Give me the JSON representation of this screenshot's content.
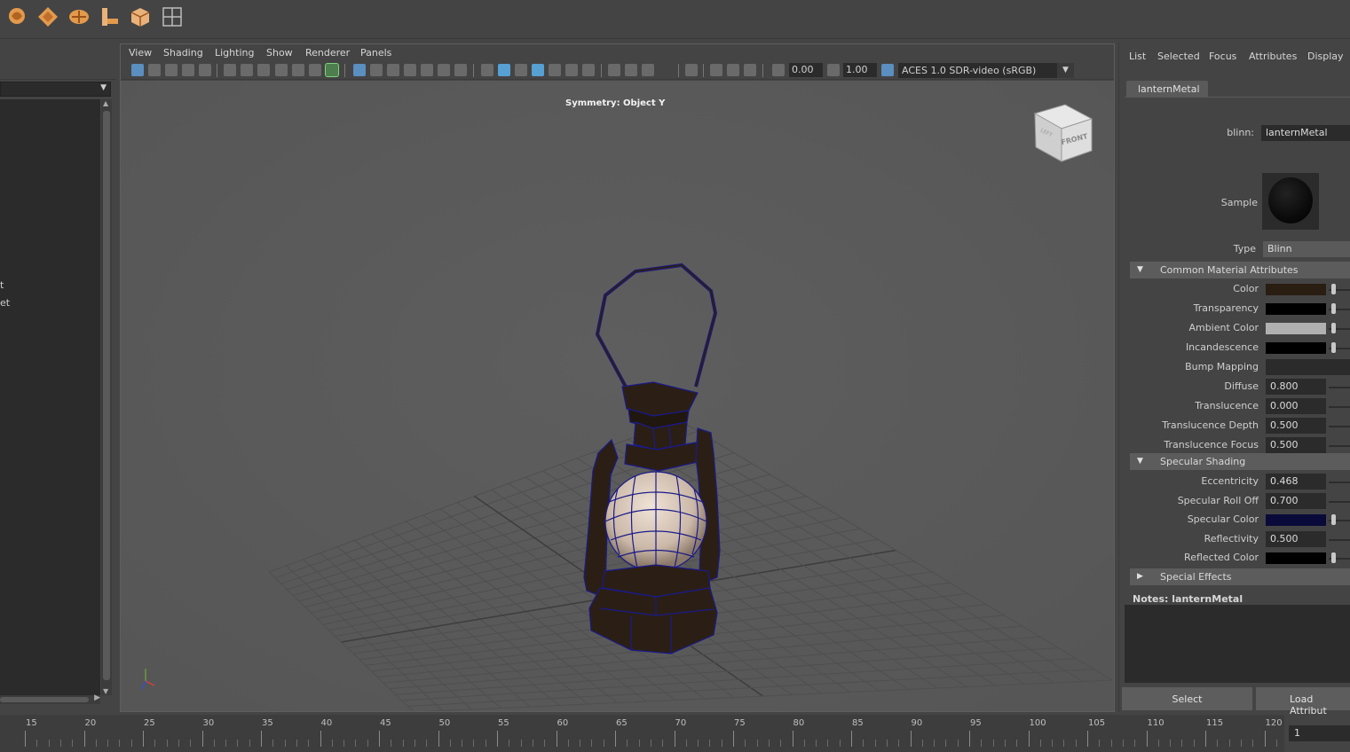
{
  "shelf": {
    "icons": [
      "lasso-select-icon",
      "diamond-select-icon",
      "paint-select-icon",
      "move-tool-icon",
      "cube-tool-icon",
      "grid-layout-icon"
    ]
  },
  "outliner": {
    "partial_items": [
      "t",
      "et"
    ]
  },
  "viewport": {
    "menus": [
      "View",
      "Shading",
      "Lighting",
      "Show",
      "Renderer",
      "Panels"
    ],
    "exposure": "0.00",
    "gamma": "1.00",
    "color_space": "ACES 1.0 SDR-video (sRGB)",
    "symmetry_label": "Symmetry: Object Y",
    "view_cube_front": "FRONT",
    "view_cube_left": "LEFT"
  },
  "attribute_editor": {
    "menus": [
      "List",
      "Selected",
      "Focus",
      "Attributes",
      "Display"
    ],
    "tab": "lanternMetal",
    "node_type_label": "blinn:",
    "node_name": "lanternMetal",
    "sample_label": "Sample",
    "type_label": "Type",
    "type_value": "Blinn",
    "sections": {
      "common": "Common Material Attributes",
      "specular": "Specular Shading",
      "special": "Special Effects"
    },
    "common_attrs": [
      {
        "label": "Color",
        "kind": "swatch",
        "color": "#2a1d12"
      },
      {
        "label": "Transparency",
        "kind": "swatch",
        "color": "#000000"
      },
      {
        "label": "Ambient Color",
        "kind": "swatch",
        "color": "#b0b0b0"
      },
      {
        "label": "Incandescence",
        "kind": "swatch",
        "color": "#000000"
      },
      {
        "label": "Bump Mapping",
        "kind": "field",
        "value": ""
      },
      {
        "label": "Diffuse",
        "kind": "value",
        "value": "0.800"
      },
      {
        "label": "Translucence",
        "kind": "value",
        "value": "0.000"
      },
      {
        "label": "Translucence Depth",
        "kind": "value",
        "value": "0.500"
      },
      {
        "label": "Translucence Focus",
        "kind": "value",
        "value": "0.500"
      }
    ],
    "specular_attrs": [
      {
        "label": "Eccentricity",
        "kind": "value",
        "value": "0.468"
      },
      {
        "label": "Specular Roll Off",
        "kind": "value",
        "value": "0.700"
      },
      {
        "label": "Specular Color",
        "kind": "swatch",
        "color": "#0a0a3a"
      },
      {
        "label": "Reflectivity",
        "kind": "value",
        "value": "0.500"
      },
      {
        "label": "Reflected Color",
        "kind": "swatch",
        "color": "#000000"
      }
    ],
    "notes_label": "Notes:  lanternMetal",
    "select_button": "Select",
    "load_button": "Load Attribut"
  },
  "timeline": {
    "ticks": [
      "15",
      "20",
      "25",
      "30",
      "35",
      "40",
      "45",
      "50",
      "55",
      "60",
      "65",
      "70",
      "75",
      "80",
      "85",
      "90",
      "95",
      "100",
      "105",
      "110",
      "115",
      "120"
    ],
    "current_frame": "1"
  },
  "colors": {
    "wireframe": "#1a1a8a",
    "lantern_body": "#2b1f15",
    "glass": "#cbb8a8",
    "viewport_bg": "#5b5b5b"
  }
}
